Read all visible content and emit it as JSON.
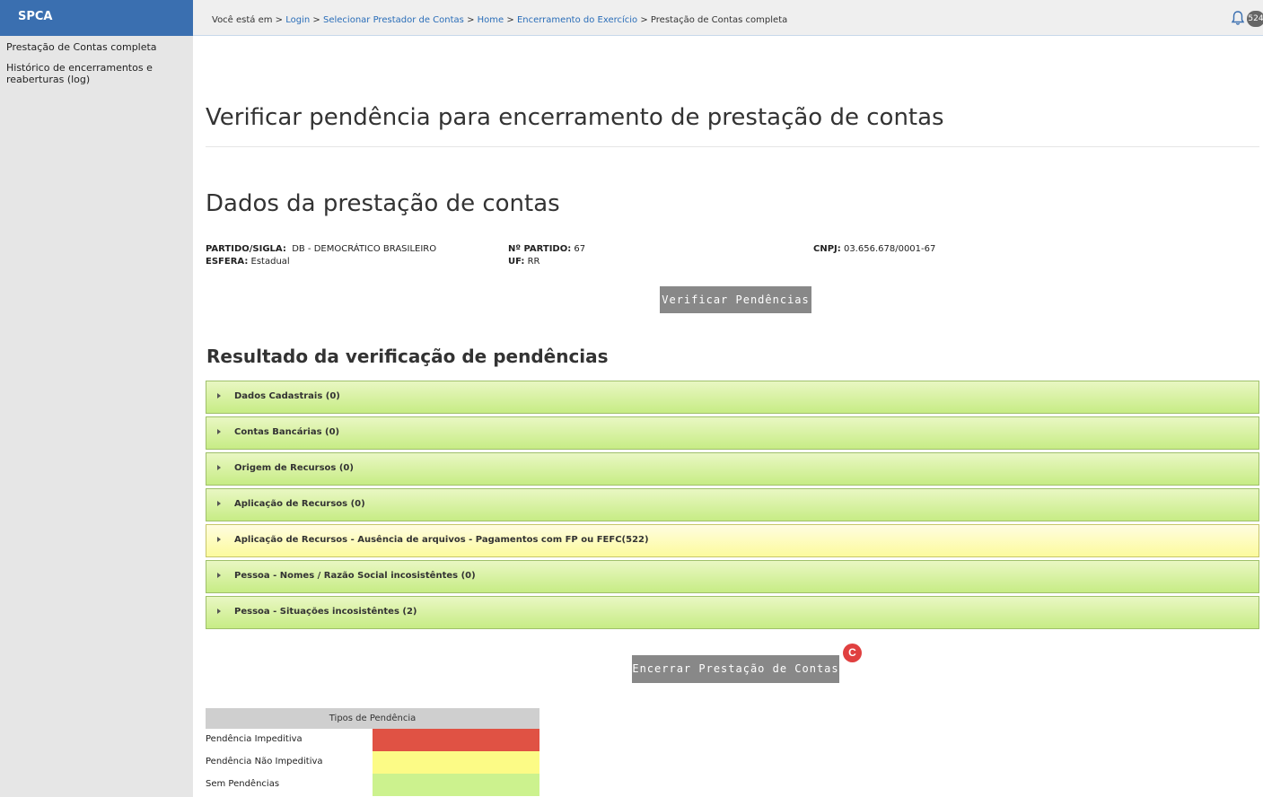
{
  "app": {
    "brand": "SPCA"
  },
  "sidebar": {
    "items": [
      {
        "label": "Prestação de Contas completa"
      },
      {
        "label": "Histórico de encerramentos e reaberturas (log)"
      }
    ]
  },
  "breadcrumb": {
    "prefix": "Você está em >",
    "links": [
      "Login",
      "Selecionar Prestador de Contas",
      "Home",
      "Encerramento do Exercício"
    ],
    "current": "Prestação de Contas completa",
    "separator": ">"
  },
  "notifications": {
    "count": "524"
  },
  "page": {
    "title": "Verificar pendência para encerramento de prestação de contas",
    "section_title": "Dados da prestação de contas",
    "result_title": "Resultado da verificação de pendências"
  },
  "info": {
    "partido_label": "PARTIDO/SIGLA:",
    "partido_value": "DB - DEMOCRÁTICO BRASILEIRO",
    "esfera_label": "ESFERA:",
    "esfera_value": "Estadual",
    "numero_label": "Nº PARTIDO:",
    "numero_value": "67",
    "uf_label": "UF:",
    "uf_value": "RR",
    "cnpj_label": "CNPJ:",
    "cnpj_value": "03.656.678/0001-67"
  },
  "buttons": {
    "verify": "Verificar Pendências",
    "close": "Encerrar Prestação de Contas",
    "badge": "C"
  },
  "pendencias": [
    {
      "label": "Dados Cadastrais (0)",
      "status": "green"
    },
    {
      "label": "Contas Bancárias (0)",
      "status": "green"
    },
    {
      "label": "Origem de Recursos (0)",
      "status": "green"
    },
    {
      "label": "Aplicação de Recursos (0)",
      "status": "green"
    },
    {
      "label": "Aplicação de Recursos - Ausência de arquivos - Pagamentos com FP ou FEFC(522)",
      "status": "yellow"
    },
    {
      "label": "Pessoa - Nomes / Razão Social incosistêntes (0)",
      "status": "green"
    },
    {
      "label": "Pessoa - Situações incosistêntes (2)",
      "status": "green"
    }
  ],
  "legend": {
    "title": "Tipos de Pendência",
    "rows": [
      {
        "label": "Pendência Impeditiva",
        "color": "#e05244"
      },
      {
        "label": "Pendência Não Impeditiva",
        "color": "#fcfb86"
      },
      {
        "label": "Sem Pendências",
        "color": "#ccf28e"
      }
    ]
  }
}
